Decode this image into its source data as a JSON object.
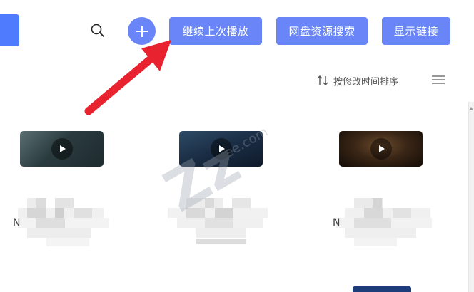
{
  "toolbar": {
    "continue_label": "继续上次播放",
    "search_label": "网盘资源搜索",
    "link_label": "显示链接",
    "accent_color": "#6a85f7",
    "search_icon": "search-icon",
    "add_icon": "plus-icon"
  },
  "sort": {
    "label": "按修改时间排序",
    "icon": "sort-arrows-icon"
  },
  "menu": {
    "icon": "hamburger-menu-icon"
  },
  "videos": [
    {
      "thumb_style": "dark-teal",
      "title_initial": "N"
    },
    {
      "thumb_style": "dark-blue",
      "title_initial": ""
    },
    {
      "thumb_style": "dark-amber",
      "title_initial": "N"
    }
  ],
  "annotation": {
    "arrow_color": "#e8232f"
  },
  "watermark": {
    "text": "Zz",
    "text2": "ee.com"
  }
}
